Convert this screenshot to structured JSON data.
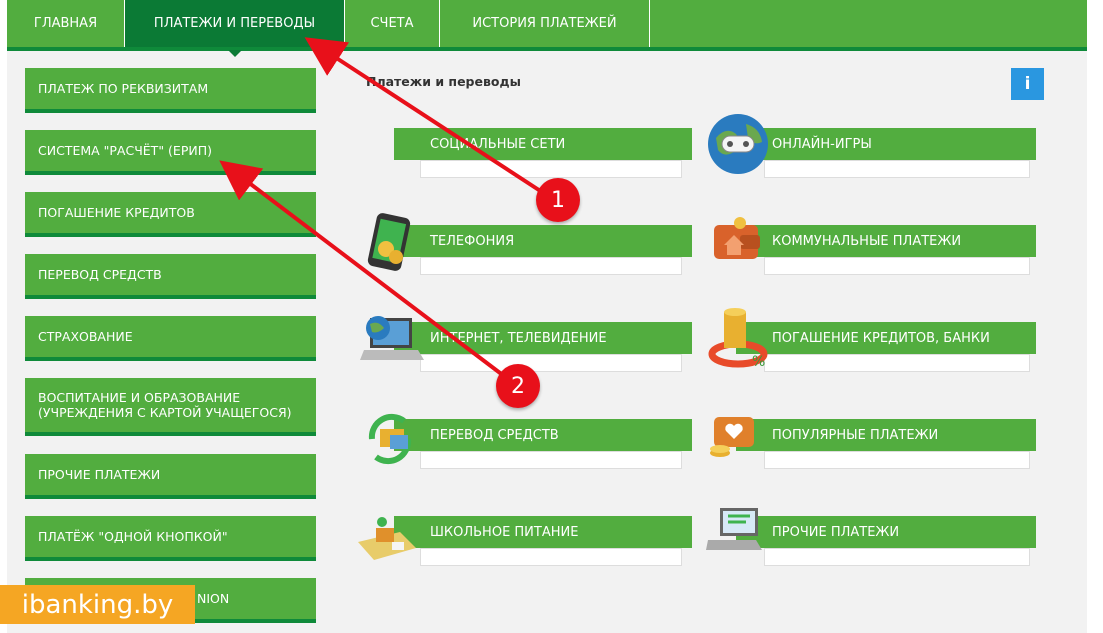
{
  "topnav": {
    "tabs": [
      {
        "label": "ГЛАВНАЯ"
      },
      {
        "label": "ПЛАТЕЖИ И ПЕРЕВОДЫ"
      },
      {
        "label": "СЧЕТА"
      },
      {
        "label": "ИСТОРИЯ ПЛАТЕЖЕЙ"
      }
    ]
  },
  "sidebar": {
    "items": [
      {
        "label": "ПЛАТЕЖ ПО РЕКВИЗИТАМ"
      },
      {
        "label": "СИСТЕМА \"РАСЧЁТ\" (ЕРИП)"
      },
      {
        "label": "ПОГАШЕНИЕ КРЕДИТОВ"
      },
      {
        "label": "ПЕРЕВОД СРЕДСТВ"
      },
      {
        "label": "СТРАХОВАНИЕ"
      },
      {
        "label": "ВОСПИТАНИЕ И ОБРАЗОВАНИЕ (УЧРЕЖДЕНИЯ С КАРТОЙ УЧАЩЕГОСЯ)"
      },
      {
        "label": "ПРОЧИЕ ПЛАТЕЖИ"
      },
      {
        "label": "ПЛАТЁЖ \"ОДНОЙ КНОПКОЙ\""
      },
      {
        "label": "NION"
      }
    ]
  },
  "main": {
    "title": "Платежи и переводы",
    "info_label": "i",
    "tiles": [
      {
        "label": "СОЦИАЛЬНЫЕ СЕТИ"
      },
      {
        "label": "ОНЛАЙН-ИГРЫ"
      },
      {
        "label": "ТЕЛЕФОНИЯ"
      },
      {
        "label": "КОММУНАЛЬНЫЕ ПЛАТЕЖИ"
      },
      {
        "label": "ИНТЕРНЕТ, ТЕЛЕВИДЕНИЕ"
      },
      {
        "label": "ПОГАШЕНИЕ КРЕДИТОВ, БАНКИ"
      },
      {
        "label": "ПЕРЕВОД СРЕДСТВ"
      },
      {
        "label": "ПОПУЛЯРНЫЕ ПЛАТЕЖИ"
      },
      {
        "label": "ШКОЛЬНОЕ ПИТАНИЕ"
      },
      {
        "label": "ПРОЧИЕ ПЛАТЕЖИ"
      }
    ]
  },
  "annotations": {
    "badge1": "1",
    "badge2": "2"
  },
  "watermark": "ibanking.by",
  "colors": {
    "green": "#52ad3f",
    "dark_green": "#0b7a35",
    "accent_red": "#e8101a",
    "info_blue": "#2a97e0",
    "watermark_orange": "#f5a623"
  }
}
